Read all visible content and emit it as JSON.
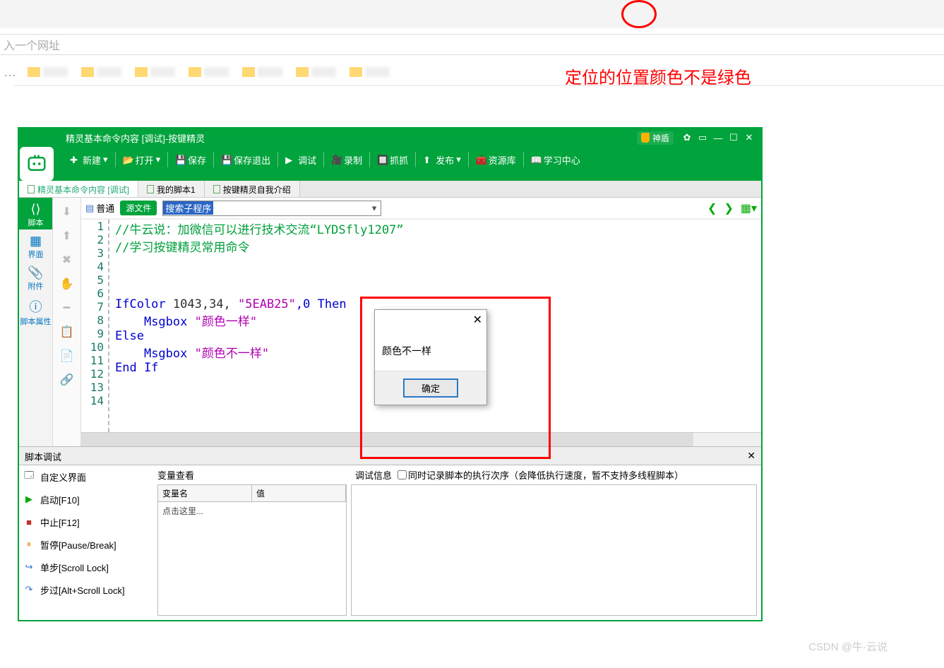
{
  "browser": {
    "address_hint": "入一个网址"
  },
  "annotations": {
    "red_text": "定位的位置颜色不是绿色"
  },
  "watermark": "CSDN @牛·云说",
  "window": {
    "title": "精灵基本命令内容 [调试]-按键精灵",
    "shendun": "神盾"
  },
  "toolbar": {
    "new": "新建",
    "open": "打开",
    "save": "保存",
    "save_exit": "保存退出",
    "debug": "调试",
    "record": "录制",
    "capture": "抓抓",
    "publish": "发布",
    "resource": "资源库",
    "learn": "学习中心"
  },
  "tabs": {
    "t1": "精灵基本命令内容 [调试]",
    "t2": "我的脚本1",
    "t3": "按键精灵自我介绍"
  },
  "sidebar": {
    "script": "脚本",
    "ui": "界面",
    "attach": "附件",
    "prop": "脚本属性"
  },
  "editor_bar": {
    "plain": "普通",
    "source": "源文件",
    "search": "搜索子程序"
  },
  "code": {
    "l1": "//牛云说：加微信可以进行技术交流“LYDSfly1207”",
    "l2": "//学习按键精灵常用命令",
    "l6_kw": "IfColor",
    "l6_num": " 1043,34, ",
    "l6_str": "\"5EAB25\"",
    "l6_tail": ",0 Then",
    "l7_kw": "Msgbox ",
    "l7_str": "\"颜色一样\"",
    "l8": "Else",
    "l9_kw": "Msgbox ",
    "l9_str": "\"颜色不一样\"",
    "l10": "End If"
  },
  "debug": {
    "title": "脚本调试",
    "custom_ui": "自定义界面",
    "start": "启动[F10]",
    "stop": "中止[F12]",
    "pause": "暂停[Pause/Break]",
    "step": "单步[Scroll Lock]",
    "step_over": "步过[Alt+Scroll Lock]",
    "var_watch": "变量查看",
    "var_name": "变量名",
    "var_value": "值",
    "click_here": "点击这里...",
    "debug_info": "调试信息",
    "record_exec": "同时记录脚本的执行次序（会降低执行速度，暂不支持多线程脚本）"
  },
  "msgbox": {
    "text": "颜色不一样",
    "ok": "确定"
  }
}
